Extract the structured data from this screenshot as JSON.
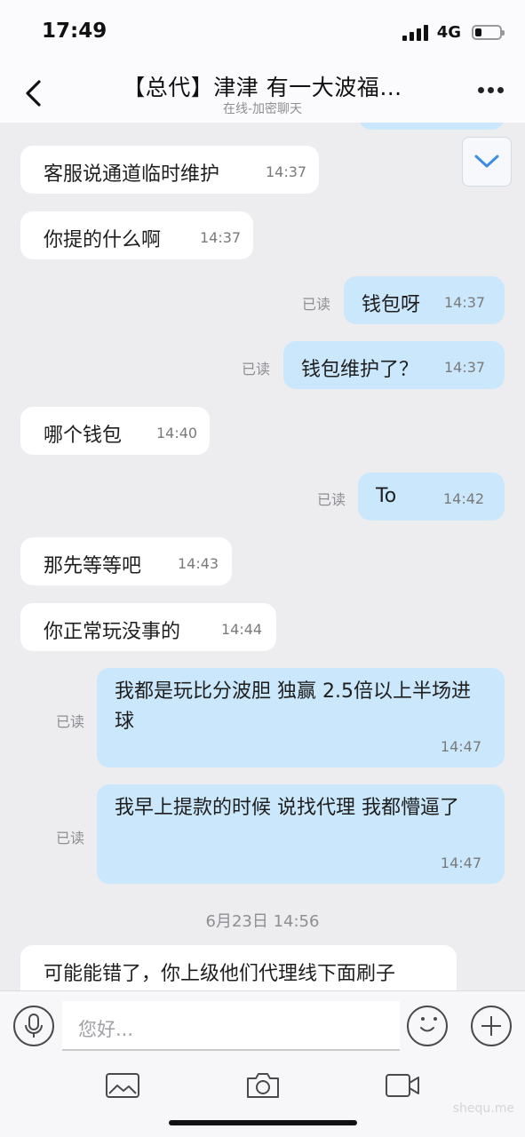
{
  "status_bar": {
    "time": "17:49",
    "network": "4G",
    "battery_level": 0.25
  },
  "nav": {
    "title": "【总代】津津 有一大波福…",
    "subtitle": "在线-加密聊天"
  },
  "messages": [
    {
      "side": "in",
      "text": "客服说通道临时维护",
      "time": "14:37"
    },
    {
      "side": "in",
      "text": "你提的什么啊",
      "time": "14:37"
    },
    {
      "side": "out",
      "text": "钱包呀",
      "time": "14:37",
      "read": "已读"
    },
    {
      "side": "out",
      "text": "钱包维护了？",
      "time": "14:37",
      "read": "已读"
    },
    {
      "side": "in",
      "text": "哪个钱包",
      "time": "14:40"
    },
    {
      "side": "out",
      "text": "To",
      "time": "14:42",
      "read": "已读"
    },
    {
      "side": "in",
      "text": "那先等等吧",
      "time": "14:43"
    },
    {
      "side": "in",
      "text": "你正常玩没事的",
      "time": "14:44"
    },
    {
      "side": "out",
      "text": "我都是玩比分波胆 独赢 2.5倍以上半场进球",
      "time": "14:47",
      "read": "已读"
    },
    {
      "side": "out",
      "text": "我早上提款的时候 说找代理 我都懵逼了",
      "time": "14:47",
      "read": "已读"
    },
    {
      "side": "in",
      "text": "可能能错了，你上级他们代理线下面刷子",
      "time": ""
    }
  ],
  "date_separator": "6月23日 14:56",
  "input": {
    "placeholder": "您好..."
  },
  "watermark": "shequ.me"
}
